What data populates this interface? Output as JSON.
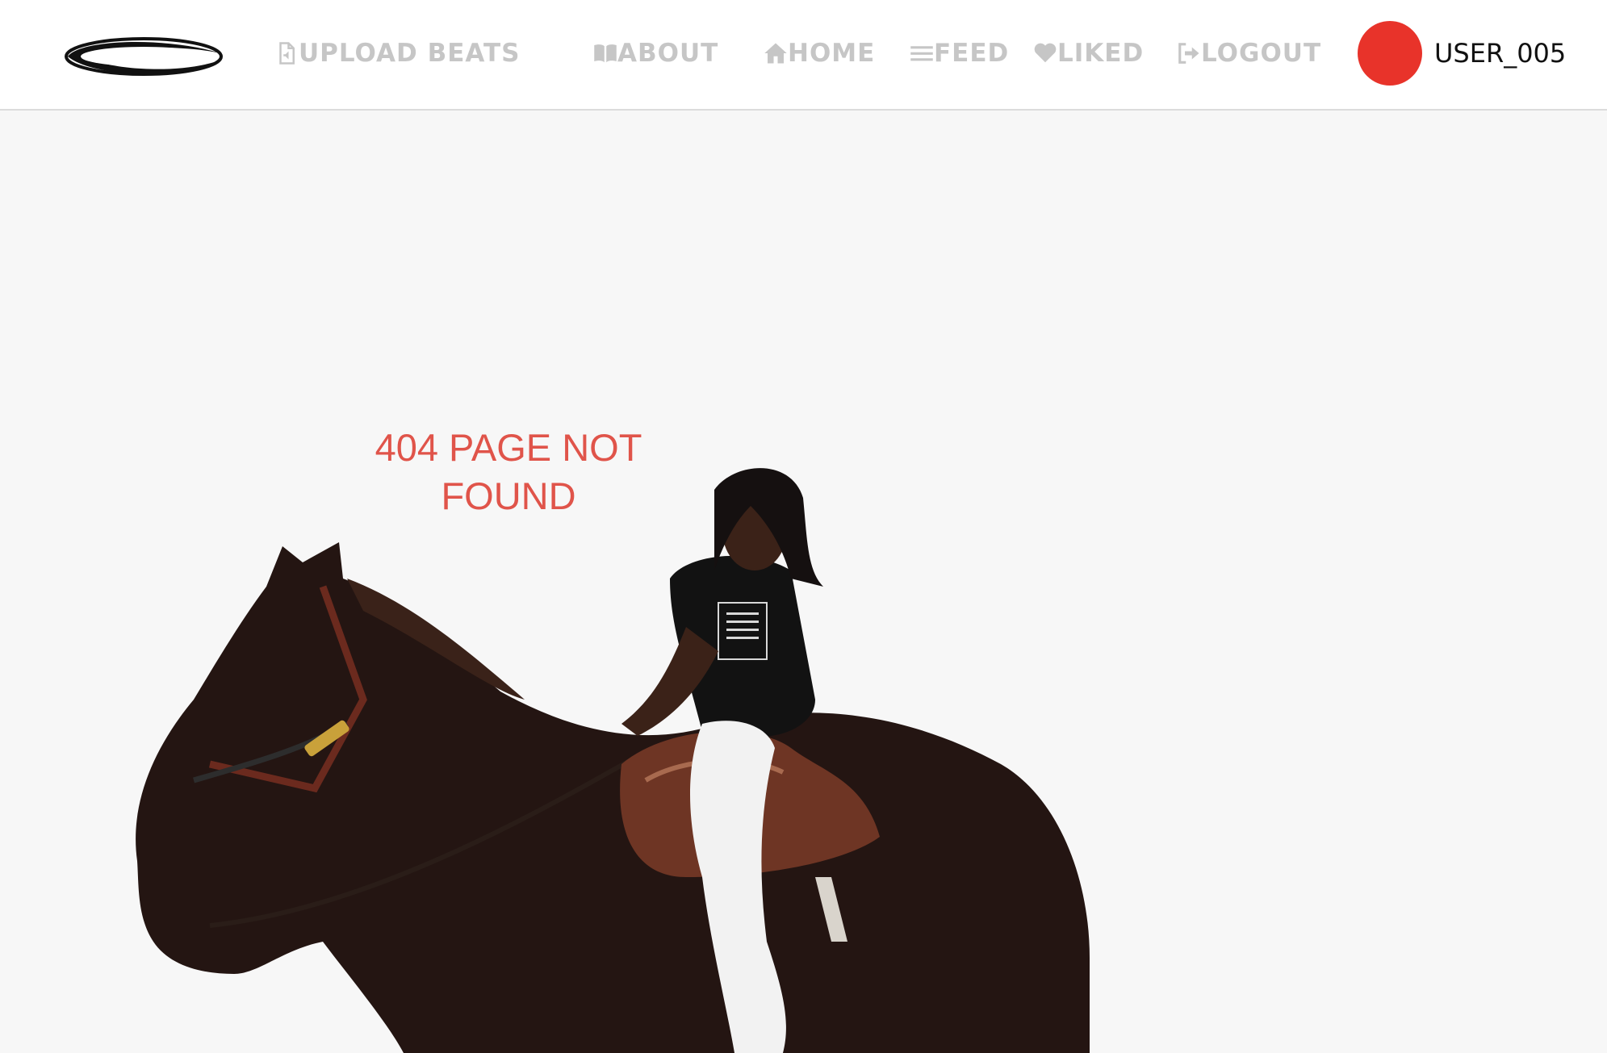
{
  "header": {
    "logo": {
      "icon": "swoosh-logo",
      "color": "#111111"
    },
    "nav": {
      "upload_beats": {
        "label": "UPLOAD BEATS",
        "icon": "file-audio-icon"
      },
      "about": {
        "label": "ABOUT",
        "icon": "book-open-icon"
      },
      "home": {
        "label": "HOME",
        "icon": "home-icon"
      },
      "feed": {
        "label": "FEED",
        "icon": "menu-lines-icon"
      },
      "liked": {
        "label": "LIKED",
        "icon": "heart-icon"
      },
      "logout": {
        "label": "LOGOUT",
        "icon": "sign-out-icon"
      }
    },
    "nav_color": "#c6c6c6",
    "user": {
      "name": "USER_005",
      "avatar_color": "#e8332a"
    }
  },
  "main": {
    "error": {
      "line1": "404 PAGE NOT",
      "line2": "FOUND",
      "color": "#e0544a"
    },
    "image": "rider-on-horse-photo"
  }
}
